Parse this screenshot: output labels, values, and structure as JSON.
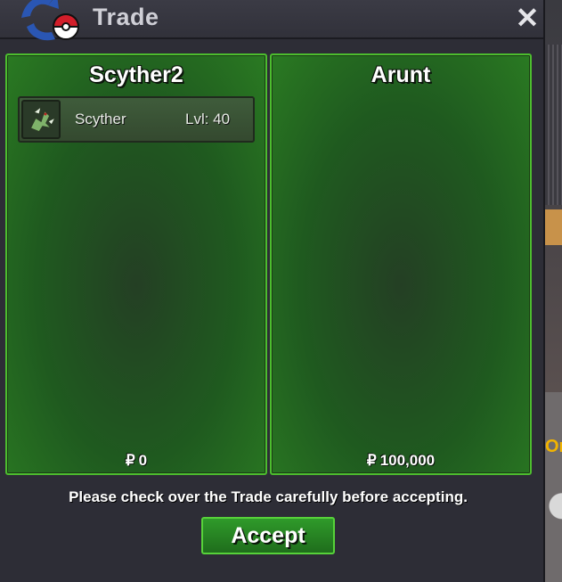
{
  "window": {
    "title": "Trade",
    "close_label": "✕"
  },
  "left_panel": {
    "player_name": "Scyther2",
    "pokemon": [
      {
        "name": "Scyther",
        "level": "Lvl: 40",
        "icon": "scyther-sprite-icon"
      }
    ],
    "currency_symbol": "₽",
    "money": "0"
  },
  "right_panel": {
    "player_name": "Arunt",
    "pokemon": [],
    "currency_symbol": "₽",
    "money": "100,000"
  },
  "notice": "Please check over the Trade carefully before accepting.",
  "accept_label": "Accept",
  "background_fragment": "Or",
  "colors": {
    "panel_border": "#4cbd2e",
    "panel_fill": "#1f5a1f",
    "window_bg": "#2d2d36"
  }
}
